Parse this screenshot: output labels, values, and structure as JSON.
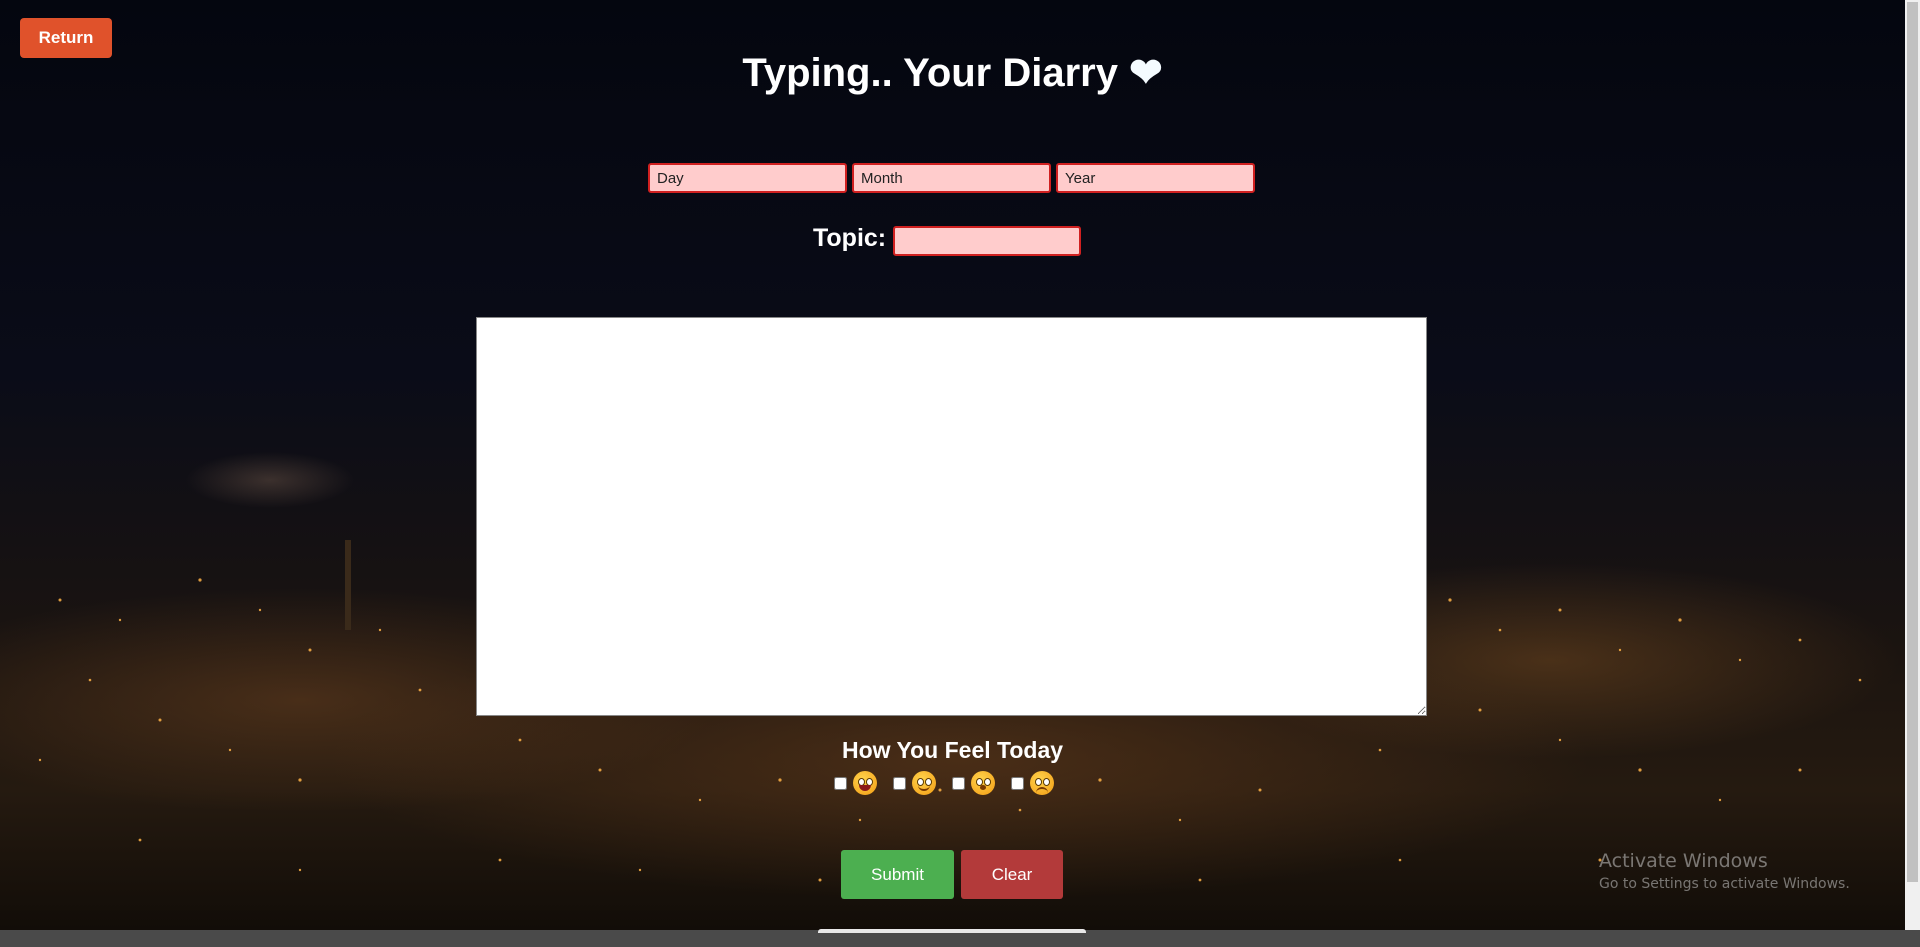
{
  "header": {
    "return_label": "Return",
    "title": "Typing.. Your Diarry",
    "heart": "❤"
  },
  "date": {
    "day_placeholder": "Day",
    "month_placeholder": "Month",
    "year_placeholder": "Year"
  },
  "topic": {
    "label": "Topic:",
    "value": ""
  },
  "diary": {
    "value": ""
  },
  "mood": {
    "title": "How You Feel Today",
    "options": [
      {
        "icon": "tongue-out-emoji-icon",
        "checked": false
      },
      {
        "icon": "smiling-emoji-icon",
        "checked": false
      },
      {
        "icon": "surprised-emoji-icon",
        "checked": false
      },
      {
        "icon": "sad-emoji-icon",
        "checked": false
      }
    ]
  },
  "actions": {
    "submit_label": "Submit",
    "clear_label": "Clear",
    "submit_color": "#4caf50",
    "clear_color": "#b33a3a",
    "return_color": "#e0522b"
  },
  "watermark": {
    "line1": "Activate Windows",
    "line2": "Go to Settings to activate Windows."
  }
}
